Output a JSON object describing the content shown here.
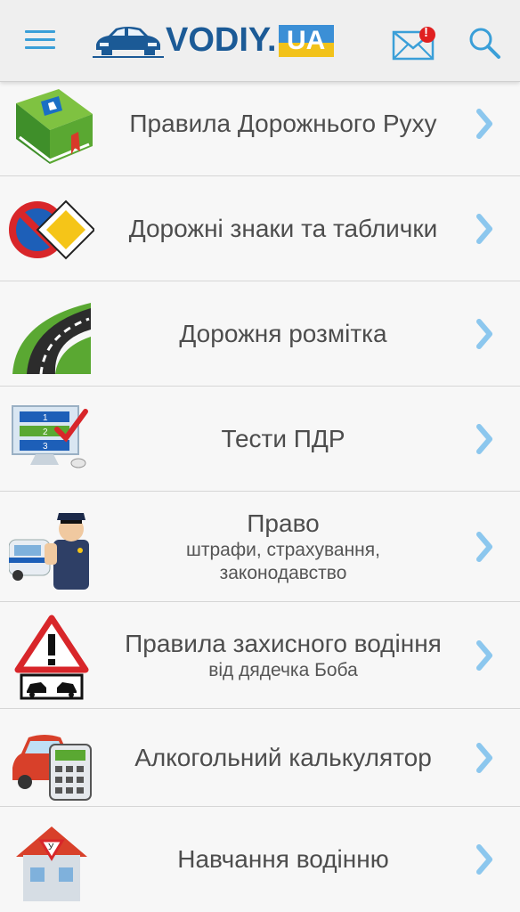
{
  "header": {
    "logo_text": "VODIY.",
    "logo_ua": "UA",
    "notification_badge": "!"
  },
  "menu": [
    {
      "title": "Правила Дорожнього Руху",
      "subtitle": "",
      "icon": "rules-book-icon"
    },
    {
      "title": "Дорожні знаки та таблички",
      "subtitle": "",
      "icon": "road-signs-icon"
    },
    {
      "title": "Дорожня розмітка",
      "subtitle": "",
      "icon": "road-marking-icon"
    },
    {
      "title": "Тести ПДР",
      "subtitle": "",
      "icon": "tests-monitor-icon"
    },
    {
      "title": "Право",
      "subtitle": "штрафи, страхування,",
      "subtitle2": "законодавство",
      "icon": "police-officer-icon"
    },
    {
      "title": "Правила захисного водіння",
      "subtitle": "від дядечка Боба",
      "icon": "warning-crash-icon"
    },
    {
      "title": "Алкогольний калькулятор",
      "subtitle": "",
      "icon": "car-calculator-icon"
    },
    {
      "title": "Навчання водінню",
      "subtitle": "",
      "icon": "driving-school-house-icon"
    }
  ],
  "colors": {
    "accent": "#3a9fd8",
    "logo_blue": "#1b5a96",
    "chevron": "#8cc7ee",
    "badge": "#e02020"
  }
}
